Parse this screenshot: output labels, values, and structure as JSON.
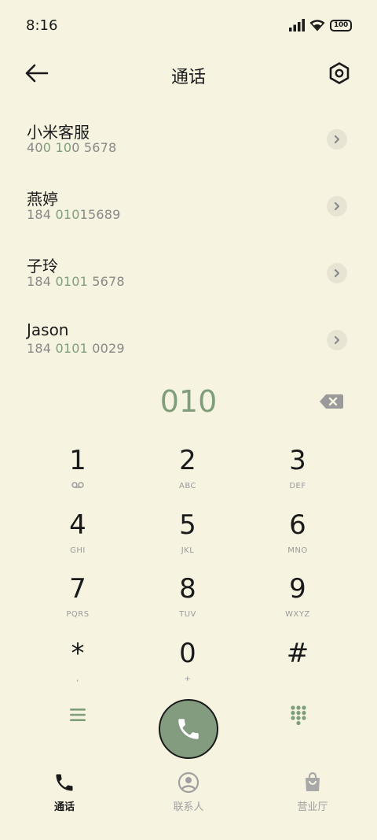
{
  "status_bar": {
    "time": "8:16",
    "battery": "100",
    "icons": [
      "signal-icon",
      "wifi-icon",
      "battery-icon"
    ]
  },
  "header": {
    "title": "通话",
    "back_icon": "arrow-left-icon",
    "settings_icon": "hexagon-gear-icon"
  },
  "results": [
    {
      "name": "小米客服",
      "number_parts": [
        "40",
        "0",
        " ",
        "10",
        "0 5678"
      ]
    },
    {
      "name": "燕婷",
      "number_parts": [
        "184 ",
        "010",
        "",
        "",
        "15689"
      ]
    },
    {
      "name": "子玲",
      "number_parts": [
        "184 ",
        "0101",
        "",
        "",
        " 5678"
      ]
    },
    {
      "name": "Jason",
      "number_parts": [
        "184 ",
        "0101",
        "",
        "",
        " 0029"
      ]
    }
  ],
  "dialed_number": "010",
  "keypad": [
    {
      "digit": "1",
      "letters": ""
    },
    {
      "digit": "2",
      "letters": "ABC"
    },
    {
      "digit": "3",
      "letters": "DEF"
    },
    {
      "digit": "4",
      "letters": "GHI"
    },
    {
      "digit": "5",
      "letters": "JKL"
    },
    {
      "digit": "6",
      "letters": "MNO"
    },
    {
      "digit": "7",
      "letters": "PQRS"
    },
    {
      "digit": "8",
      "letters": "TUV"
    },
    {
      "digit": "9",
      "letters": "WXYZ"
    },
    {
      "digit": "*",
      "letters": ","
    },
    {
      "digit": "0",
      "letters": "+"
    },
    {
      "digit": "#",
      "letters": ""
    }
  ],
  "tabs": [
    {
      "label": "通话",
      "icon": "phone-icon",
      "active": true
    },
    {
      "label": "联系人",
      "icon": "person-icon",
      "active": false
    },
    {
      "label": "营业厅",
      "icon": "shopping-bag-icon",
      "active": false
    }
  ],
  "colors": {
    "background": "#f6f3e1",
    "accent": "#7f9e7a",
    "call_button": "#839c80",
    "text": "#1a1a1a",
    "muted": "#888888"
  }
}
